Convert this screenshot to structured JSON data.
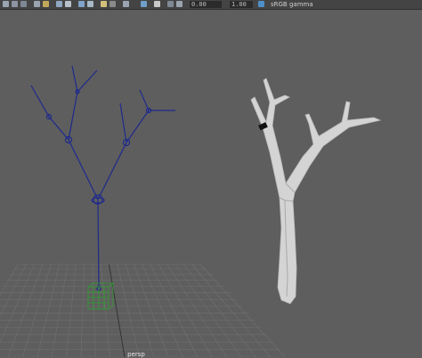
{
  "toolbar": {
    "icons": [
      {
        "name": "select-tool-icon",
        "color": "#9aa4b0"
      },
      {
        "name": "lasso-tool-icon",
        "color": "#8c95a1"
      },
      {
        "name": "paint-tool-icon",
        "color": "#7f8895"
      },
      {
        "name": "camera-icon",
        "color": "#9aa4b0"
      },
      {
        "name": "bookmark-icon",
        "color": "#c2a85a"
      },
      {
        "name": "grid-toggle-icon",
        "color": "#8da6c2"
      },
      {
        "name": "wireframe-icon",
        "color": "#b8c2cc"
      },
      {
        "name": "shaded-icon",
        "color": "#7fa3c9"
      },
      {
        "name": "textured-icon",
        "color": "#a8b8c8"
      },
      {
        "name": "lights-icon",
        "color": "#d4c07a"
      },
      {
        "name": "shadows-icon",
        "color": "#8a8a8a"
      },
      {
        "name": "ambient-occlusion-icon",
        "color": "#9aa4b0"
      },
      {
        "name": "xray-icon",
        "color": "#6f9ec9"
      },
      {
        "name": "isolate-icon",
        "color": "#c9c9c9"
      },
      {
        "name": "resolution-gate-icon",
        "color": "#7f8895"
      },
      {
        "name": "film-gate-icon",
        "color": "#9aa4b0"
      }
    ],
    "exposure_value": "0.00",
    "gamma_value": "1.00",
    "color_space_label": "sRGB gamma"
  },
  "viewport": {
    "camera_name": "persp",
    "colors": {
      "background": "#5e5e5e",
      "grid": "#707070",
      "grid_axis": "#303030",
      "joint": "#1e2a8c",
      "control": "#2fa12f",
      "mesh": "#d4d4d4"
    }
  }
}
